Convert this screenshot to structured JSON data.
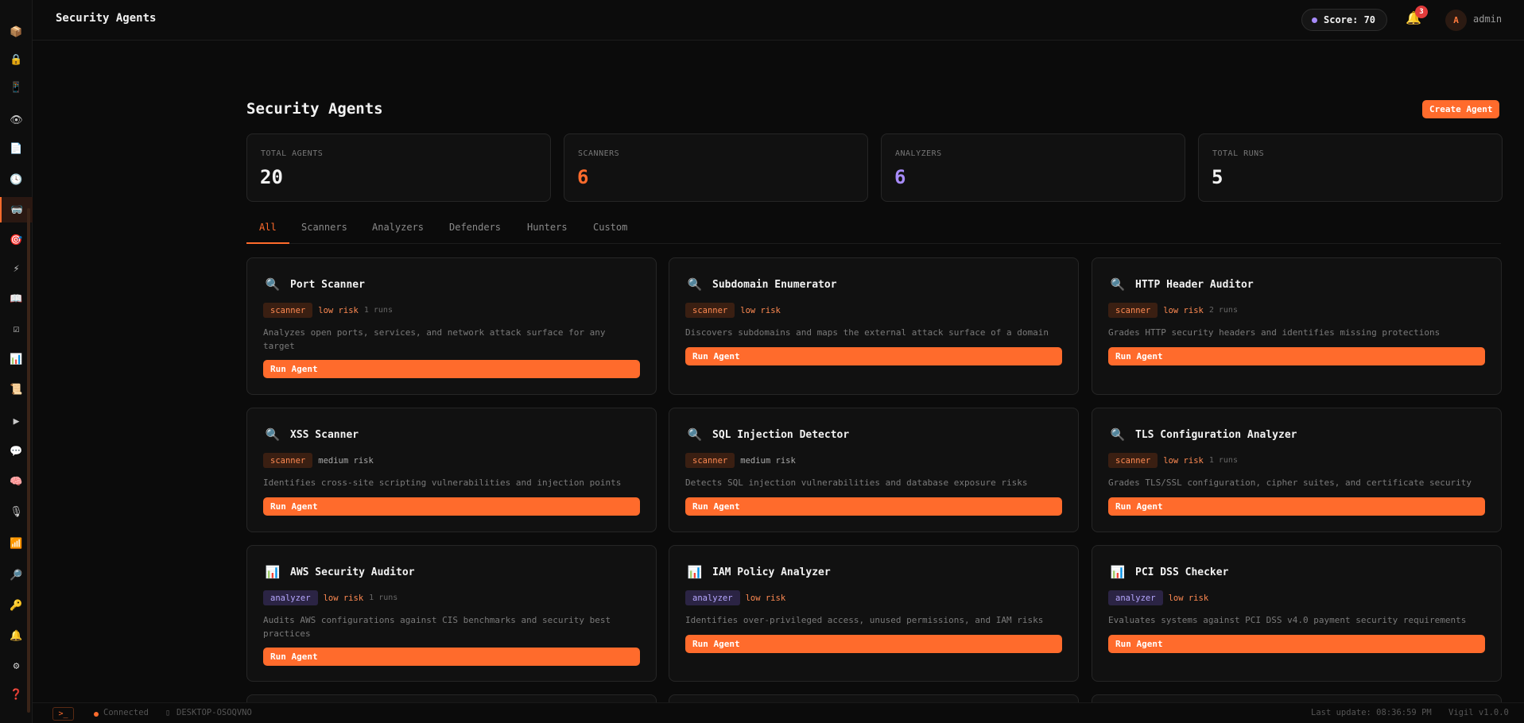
{
  "header": {
    "title": "Security Agents",
    "score": "Score: 70",
    "notifications_count": "3",
    "avatar_initial": "A",
    "username": "admin"
  },
  "sidebar": {
    "icons": [
      "package-icon",
      "lock-icon",
      "device-icon",
      "eye-icon",
      "document-icon",
      "clock-icon",
      "robot-icon",
      "target-icon",
      "lightning-icon",
      "book-icon",
      "checkbox-icon",
      "bar-chart-icon",
      "scroll-icon",
      "play-icon",
      "chat-icon",
      "brain-icon",
      "microphone-icon",
      "stats-icon",
      "magnifier-icon",
      "key-icon",
      "bell-icon",
      "gear-icon",
      "help-icon"
    ],
    "glyphs": [
      "📦",
      "🔒",
      "📱",
      "👁",
      "📄",
      "🕓",
      "🥽",
      "🎯",
      "⚡",
      "📖",
      "☑",
      "📊",
      "📜",
      "▶",
      "💬",
      "🧠",
      "🎙",
      "📶",
      "🔎",
      "🔑",
      "🔔",
      "⚙",
      "❓"
    ],
    "active_index": 6
  },
  "main": {
    "title": "Security Agents",
    "create_button": "Create Agent",
    "stats": [
      {
        "label": "TOTAL AGENTS",
        "value": "20",
        "color": "#f2f2f2"
      },
      {
        "label": "SCANNERS",
        "value": "6",
        "color": "#ff6b2c"
      },
      {
        "label": "ANALYZERS",
        "value": "6",
        "color": "#a78bfa"
      },
      {
        "label": "TOTAL RUNS",
        "value": "5",
        "color": "#f2f2f2"
      }
    ],
    "tabs": [
      {
        "label": "All",
        "active": true
      },
      {
        "label": "Scanners",
        "active": false
      },
      {
        "label": "Analyzers",
        "active": false
      },
      {
        "label": "Defenders",
        "active": false
      },
      {
        "label": "Hunters",
        "active": false
      },
      {
        "label": "Custom",
        "active": false
      }
    ],
    "run_label": "Run Agent",
    "agents": [
      {
        "name": "Port Scanner",
        "icon": "🔍",
        "type": "scanner",
        "risk": "low risk",
        "risk_level": "low",
        "runs": "1 runs",
        "desc": "Analyzes open ports, services, and network attack surface for any target"
      },
      {
        "name": "Subdomain Enumerator",
        "icon": "🔍",
        "type": "scanner",
        "risk": "low risk",
        "risk_level": "low",
        "runs": "",
        "desc": "Discovers subdomains and maps the external attack surface of a domain"
      },
      {
        "name": "HTTP Header Auditor",
        "icon": "🔍",
        "type": "scanner",
        "risk": "low risk",
        "risk_level": "low",
        "runs": "2 runs",
        "desc": "Grades HTTP security headers and identifies missing protections"
      },
      {
        "name": "XSS Scanner",
        "icon": "🔍",
        "type": "scanner",
        "risk": "medium risk",
        "risk_level": "medium",
        "runs": "",
        "desc": "Identifies cross-site scripting vulnerabilities and injection points"
      },
      {
        "name": "SQL Injection Detector",
        "icon": "🔍",
        "type": "scanner",
        "risk": "medium risk",
        "risk_level": "medium",
        "runs": "",
        "desc": "Detects SQL injection vulnerabilities and database exposure risks"
      },
      {
        "name": "TLS Configuration Analyzer",
        "icon": "🔍",
        "type": "scanner",
        "risk": "low risk",
        "risk_level": "low",
        "runs": "1 runs",
        "desc": "Grades TLS/SSL configuration, cipher suites, and certificate security"
      },
      {
        "name": "AWS Security Auditor",
        "icon": "📊",
        "type": "analyzer",
        "risk": "low risk",
        "risk_level": "low",
        "runs": "1 runs",
        "desc": "Audits AWS configurations against CIS benchmarks and security best practices"
      },
      {
        "name": "IAM Policy Analyzer",
        "icon": "📊",
        "type": "analyzer",
        "risk": "low risk",
        "risk_level": "low",
        "runs": "",
        "desc": "Identifies over-privileged access, unused permissions, and IAM risks"
      },
      {
        "name": "PCI DSS Checker",
        "icon": "📊",
        "type": "analyzer",
        "risk": "low risk",
        "risk_level": "low",
        "runs": "",
        "desc": "Evaluates systems against PCI DSS v4.0 payment security requirements"
      }
    ]
  },
  "footer": {
    "terminal_glyph": ">_",
    "status": "Connected",
    "host": "DESKTOP-OSOQVNO",
    "last_update": "Last update: 08:36:59 PM",
    "version": "Vigil v1.0.0"
  }
}
